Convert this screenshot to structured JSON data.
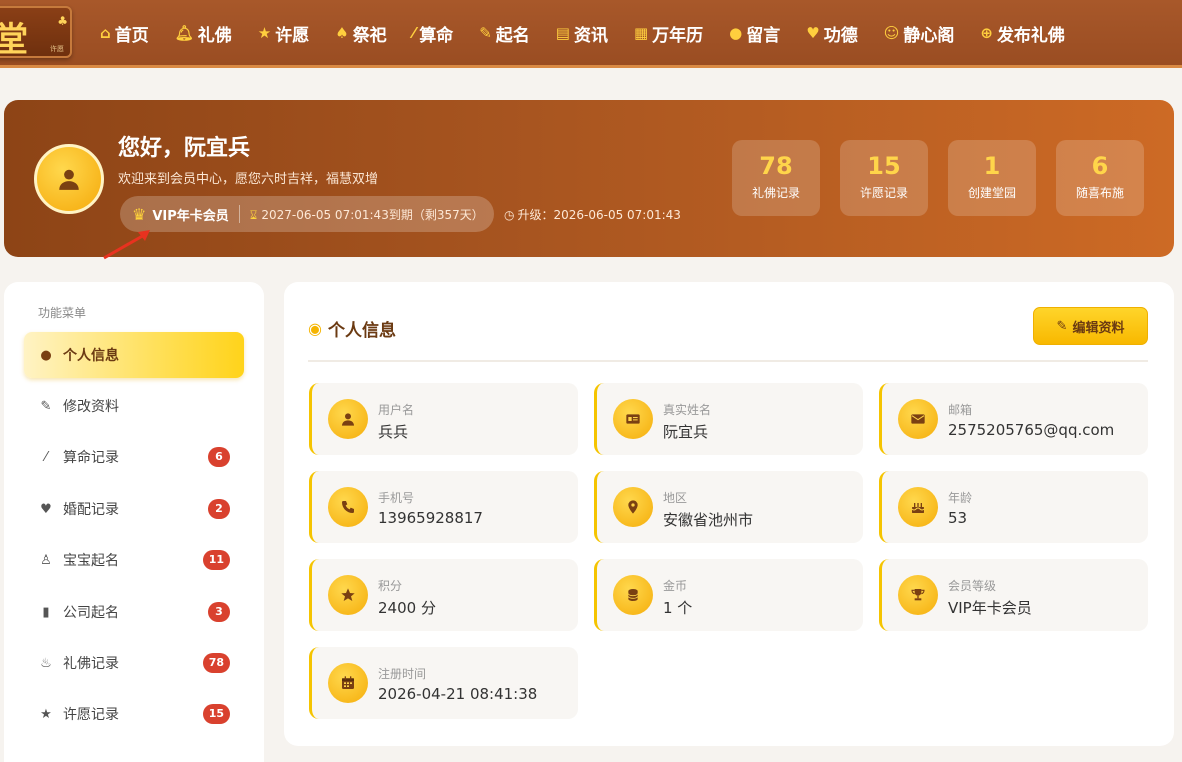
{
  "nav": {
    "logo_text": "堂",
    "logo_small": "许愿",
    "items": [
      {
        "icon": "home-icon",
        "label": "首页"
      },
      {
        "icon": "bell-icon",
        "label": "礼佛"
      },
      {
        "icon": "star-icon",
        "label": "许愿"
      },
      {
        "icon": "tree-icon",
        "label": "祭祀"
      },
      {
        "icon": "magic-wand-icon",
        "label": "算命"
      },
      {
        "icon": "pencil-icon",
        "label": "起名"
      },
      {
        "icon": "newspaper-icon",
        "label": "资讯"
      },
      {
        "icon": "calendar-icon",
        "label": "万年历"
      },
      {
        "icon": "comment-icon",
        "label": "留言"
      },
      {
        "icon": "heart-icon",
        "label": "功德"
      },
      {
        "icon": "smile-icon",
        "label": "静心阁"
      },
      {
        "icon": "plus-circle-icon",
        "label": "发布礼佛"
      }
    ]
  },
  "banner": {
    "greeting": "您好，阮宜兵",
    "welcome": "欢迎来到会员中心，愿您六时吉祥，福慧双增",
    "vip_name": "VIP年卡会员",
    "vip_expire": "2027-06-05 07:01:43到期（剩357天）",
    "upgrade": "升级：2026-06-05 07:01:43",
    "stats": [
      {
        "value": "78",
        "label": "礼佛记录"
      },
      {
        "value": "15",
        "label": "许愿记录"
      },
      {
        "value": "1",
        "label": "创建堂园"
      },
      {
        "value": "6",
        "label": "随喜布施"
      }
    ]
  },
  "sidebar": {
    "title": "功能菜单",
    "items": [
      {
        "icon": "user-icon",
        "label": "个人信息",
        "badge": ""
      },
      {
        "icon": "edit-icon",
        "label": "修改资料",
        "badge": ""
      },
      {
        "icon": "magic-wand-icon",
        "label": "算命记录",
        "badge": "6"
      },
      {
        "icon": "heart-icon",
        "label": "婚配记录",
        "badge": "2"
      },
      {
        "icon": "child-icon",
        "label": "宝宝起名",
        "badge": "11"
      },
      {
        "icon": "building-icon",
        "label": "公司起名",
        "badge": "3"
      },
      {
        "icon": "fire-icon",
        "label": "礼佛记录",
        "badge": "78"
      },
      {
        "icon": "star-icon",
        "label": "许愿记录",
        "badge": "15"
      }
    ]
  },
  "main": {
    "title": "个人信息",
    "edit_label": "编辑资料",
    "fields": [
      {
        "icon": "user-icon",
        "label": "用户名",
        "value": "兵兵"
      },
      {
        "icon": "id-card-icon",
        "label": "真实姓名",
        "value": "阮宜兵"
      },
      {
        "icon": "envelope-icon",
        "label": "邮箱",
        "value": "2575205765@qq.com"
      },
      {
        "icon": "phone-icon",
        "label": "手机号",
        "value": "13965928817"
      },
      {
        "icon": "map-marker-icon",
        "label": "地区",
        "value": "安徽省池州市"
      },
      {
        "icon": "birthday-cake-icon",
        "label": "年龄",
        "value": "53"
      },
      {
        "icon": "star-icon",
        "label": "积分",
        "value": "2400 分"
      },
      {
        "icon": "coins-icon",
        "label": "金币",
        "value": "1 个"
      },
      {
        "icon": "trophy-icon",
        "label": "会员等级",
        "value": "VIP年卡会员"
      },
      {
        "icon": "calendar-icon",
        "label": "注册时间",
        "value": "2026-04-21 08:41:38"
      }
    ]
  },
  "colors": {
    "accent": "#f5b400",
    "nav_bg": "#a0522d",
    "badge": "#d9412e",
    "brown_text": "#6b3a12"
  }
}
